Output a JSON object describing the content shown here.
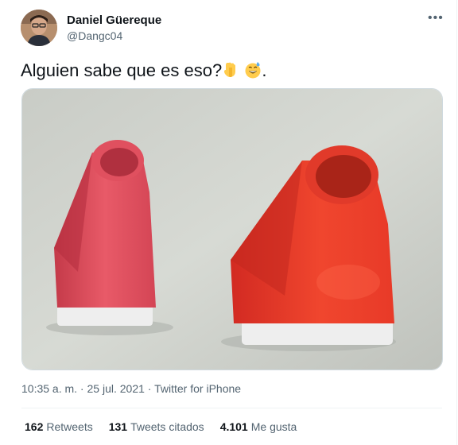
{
  "author": {
    "name": "Daniel Güereque",
    "handle": "@Dangc04"
  },
  "more_label": "•••",
  "tweet": {
    "text": "Alguien sabe que es eso?",
    "trailing": "."
  },
  "meta": {
    "time": "10:35 a. m.",
    "separator": " · ",
    "date": "25 jul. 2021",
    "source": "Twitter for iPhone"
  },
  "stats": [
    {
      "count": "162",
      "label": "Retweets"
    },
    {
      "count": "131",
      "label": "Tweets citados"
    },
    {
      "count": "4.101",
      "label": "Me gusta"
    }
  ],
  "icons": {
    "point_down": "backhand-index-pointing-down-icon",
    "sweat": "grinning-face-with-sweat-icon"
  }
}
